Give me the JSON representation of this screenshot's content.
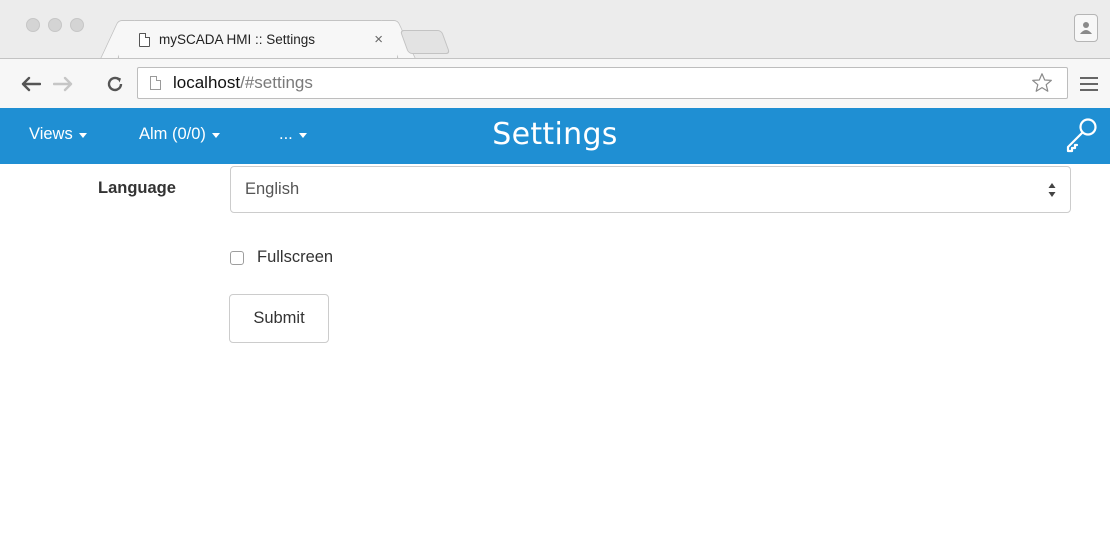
{
  "browser": {
    "tab": {
      "title": "mySCADA HMI :: Settings",
      "close_glyph": "×"
    },
    "url": {
      "host": "localhost",
      "path": "/#settings"
    }
  },
  "navbar": {
    "background_color": "#1f8fd3",
    "views_label": "Views",
    "alarms_label": "Alm (0/0)",
    "more_label": "...",
    "title": "Settings",
    "key_icon": "key-icon"
  },
  "form": {
    "language_label": "Language",
    "language_selected": "English",
    "fullscreen_label": "Fullscreen",
    "fullscreen_checked": false,
    "submit_label": "Submit"
  }
}
